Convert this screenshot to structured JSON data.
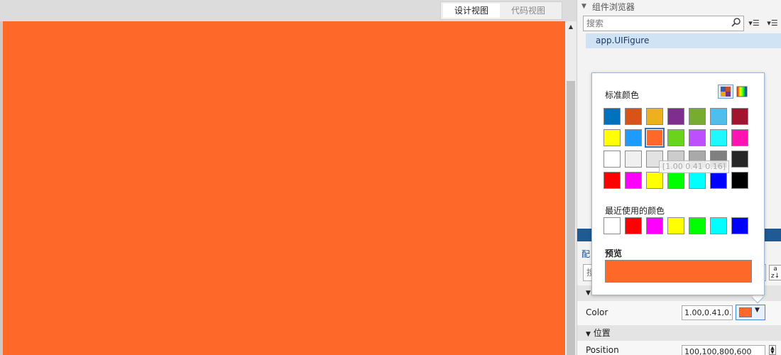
{
  "view_tabs": {
    "design": "设计视图",
    "code": "代码视图"
  },
  "component_browser": {
    "title": "组件浏览器",
    "search_placeholder": "搜索",
    "tree_item": "app.UIFigure"
  },
  "canvas": {
    "background_color": "#fe6929"
  },
  "color_picker": {
    "standard_label": "标准颜色",
    "standard_colors": [
      "#0072bd",
      "#d95319",
      "#edb120",
      "#7e2f8e",
      "#77ac30",
      "#4dbeee",
      "#a2142f",
      "#ffff00",
      "#1e9bff",
      "#fe6929",
      "#6ad41c",
      "#bd4fff",
      "#1ff8ff",
      "#ff14b1",
      "#ffffff",
      "#f0f0f0",
      "#e2e2e2",
      "#cccccc",
      "#a9a9a9",
      "#808080",
      "#262626",
      "#ff0000",
      "#ff00ff",
      "#ffff00",
      "#00ff00",
      "#00ffff",
      "#0000ff",
      "#000000"
    ],
    "selected_index": 9,
    "tooltip": "[1.00 0.41 0.16]",
    "recent_label": "最近使用的颜色",
    "recent_colors": [
      "#ffffff",
      "#ff0000",
      "#ff00ff",
      "#ffff00",
      "#00ff00",
      "#00ffff",
      "#0000ff"
    ],
    "preview_label": "预览",
    "preview_color": "#fe6929"
  },
  "inspector": {
    "label": "配",
    "search_placeholder": "搜",
    "color_label": "Color",
    "color_value": "1.00,0.41,0.",
    "color_swatch": "#fe6929",
    "position_group": "位置",
    "position_label": "Position",
    "position_value": "100,100,800,600"
  }
}
